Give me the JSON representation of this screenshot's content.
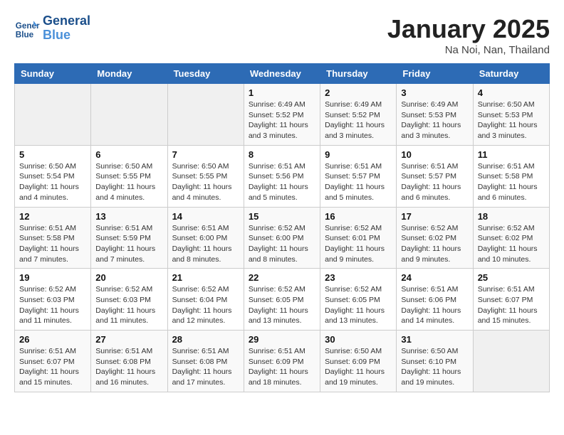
{
  "header": {
    "logo_line1": "General",
    "logo_line2": "Blue",
    "title": "January 2025",
    "subtitle": "Na Noi, Nan, Thailand"
  },
  "weekdays": [
    "Sunday",
    "Monday",
    "Tuesday",
    "Wednesday",
    "Thursday",
    "Friday",
    "Saturday"
  ],
  "weeks": [
    [
      {
        "day": "",
        "info": ""
      },
      {
        "day": "",
        "info": ""
      },
      {
        "day": "",
        "info": ""
      },
      {
        "day": "1",
        "info": "Sunrise: 6:49 AM\nSunset: 5:52 PM\nDaylight: 11 hours\nand 3 minutes."
      },
      {
        "day": "2",
        "info": "Sunrise: 6:49 AM\nSunset: 5:52 PM\nDaylight: 11 hours\nand 3 minutes."
      },
      {
        "day": "3",
        "info": "Sunrise: 6:49 AM\nSunset: 5:53 PM\nDaylight: 11 hours\nand 3 minutes."
      },
      {
        "day": "4",
        "info": "Sunrise: 6:50 AM\nSunset: 5:53 PM\nDaylight: 11 hours\nand 3 minutes."
      }
    ],
    [
      {
        "day": "5",
        "info": "Sunrise: 6:50 AM\nSunset: 5:54 PM\nDaylight: 11 hours\nand 4 minutes."
      },
      {
        "day": "6",
        "info": "Sunrise: 6:50 AM\nSunset: 5:55 PM\nDaylight: 11 hours\nand 4 minutes."
      },
      {
        "day": "7",
        "info": "Sunrise: 6:50 AM\nSunset: 5:55 PM\nDaylight: 11 hours\nand 4 minutes."
      },
      {
        "day": "8",
        "info": "Sunrise: 6:51 AM\nSunset: 5:56 PM\nDaylight: 11 hours\nand 5 minutes."
      },
      {
        "day": "9",
        "info": "Sunrise: 6:51 AM\nSunset: 5:57 PM\nDaylight: 11 hours\nand 5 minutes."
      },
      {
        "day": "10",
        "info": "Sunrise: 6:51 AM\nSunset: 5:57 PM\nDaylight: 11 hours\nand 6 minutes."
      },
      {
        "day": "11",
        "info": "Sunrise: 6:51 AM\nSunset: 5:58 PM\nDaylight: 11 hours\nand 6 minutes."
      }
    ],
    [
      {
        "day": "12",
        "info": "Sunrise: 6:51 AM\nSunset: 5:58 PM\nDaylight: 11 hours\nand 7 minutes."
      },
      {
        "day": "13",
        "info": "Sunrise: 6:51 AM\nSunset: 5:59 PM\nDaylight: 11 hours\nand 7 minutes."
      },
      {
        "day": "14",
        "info": "Sunrise: 6:51 AM\nSunset: 6:00 PM\nDaylight: 11 hours\nand 8 minutes."
      },
      {
        "day": "15",
        "info": "Sunrise: 6:52 AM\nSunset: 6:00 PM\nDaylight: 11 hours\nand 8 minutes."
      },
      {
        "day": "16",
        "info": "Sunrise: 6:52 AM\nSunset: 6:01 PM\nDaylight: 11 hours\nand 9 minutes."
      },
      {
        "day": "17",
        "info": "Sunrise: 6:52 AM\nSunset: 6:02 PM\nDaylight: 11 hours\nand 9 minutes."
      },
      {
        "day": "18",
        "info": "Sunrise: 6:52 AM\nSunset: 6:02 PM\nDaylight: 11 hours\nand 10 minutes."
      }
    ],
    [
      {
        "day": "19",
        "info": "Sunrise: 6:52 AM\nSunset: 6:03 PM\nDaylight: 11 hours\nand 11 minutes."
      },
      {
        "day": "20",
        "info": "Sunrise: 6:52 AM\nSunset: 6:03 PM\nDaylight: 11 hours\nand 11 minutes."
      },
      {
        "day": "21",
        "info": "Sunrise: 6:52 AM\nSunset: 6:04 PM\nDaylight: 11 hours\nand 12 minutes."
      },
      {
        "day": "22",
        "info": "Sunrise: 6:52 AM\nSunset: 6:05 PM\nDaylight: 11 hours\nand 13 minutes."
      },
      {
        "day": "23",
        "info": "Sunrise: 6:52 AM\nSunset: 6:05 PM\nDaylight: 11 hours\nand 13 minutes."
      },
      {
        "day": "24",
        "info": "Sunrise: 6:51 AM\nSunset: 6:06 PM\nDaylight: 11 hours\nand 14 minutes."
      },
      {
        "day": "25",
        "info": "Sunrise: 6:51 AM\nSunset: 6:07 PM\nDaylight: 11 hours\nand 15 minutes."
      }
    ],
    [
      {
        "day": "26",
        "info": "Sunrise: 6:51 AM\nSunset: 6:07 PM\nDaylight: 11 hours\nand 15 minutes."
      },
      {
        "day": "27",
        "info": "Sunrise: 6:51 AM\nSunset: 6:08 PM\nDaylight: 11 hours\nand 16 minutes."
      },
      {
        "day": "28",
        "info": "Sunrise: 6:51 AM\nSunset: 6:08 PM\nDaylight: 11 hours\nand 17 minutes."
      },
      {
        "day": "29",
        "info": "Sunrise: 6:51 AM\nSunset: 6:09 PM\nDaylight: 11 hours\nand 18 minutes."
      },
      {
        "day": "30",
        "info": "Sunrise: 6:50 AM\nSunset: 6:09 PM\nDaylight: 11 hours\nand 19 minutes."
      },
      {
        "day": "31",
        "info": "Sunrise: 6:50 AM\nSunset: 6:10 PM\nDaylight: 11 hours\nand 19 minutes."
      },
      {
        "day": "",
        "info": ""
      }
    ]
  ]
}
